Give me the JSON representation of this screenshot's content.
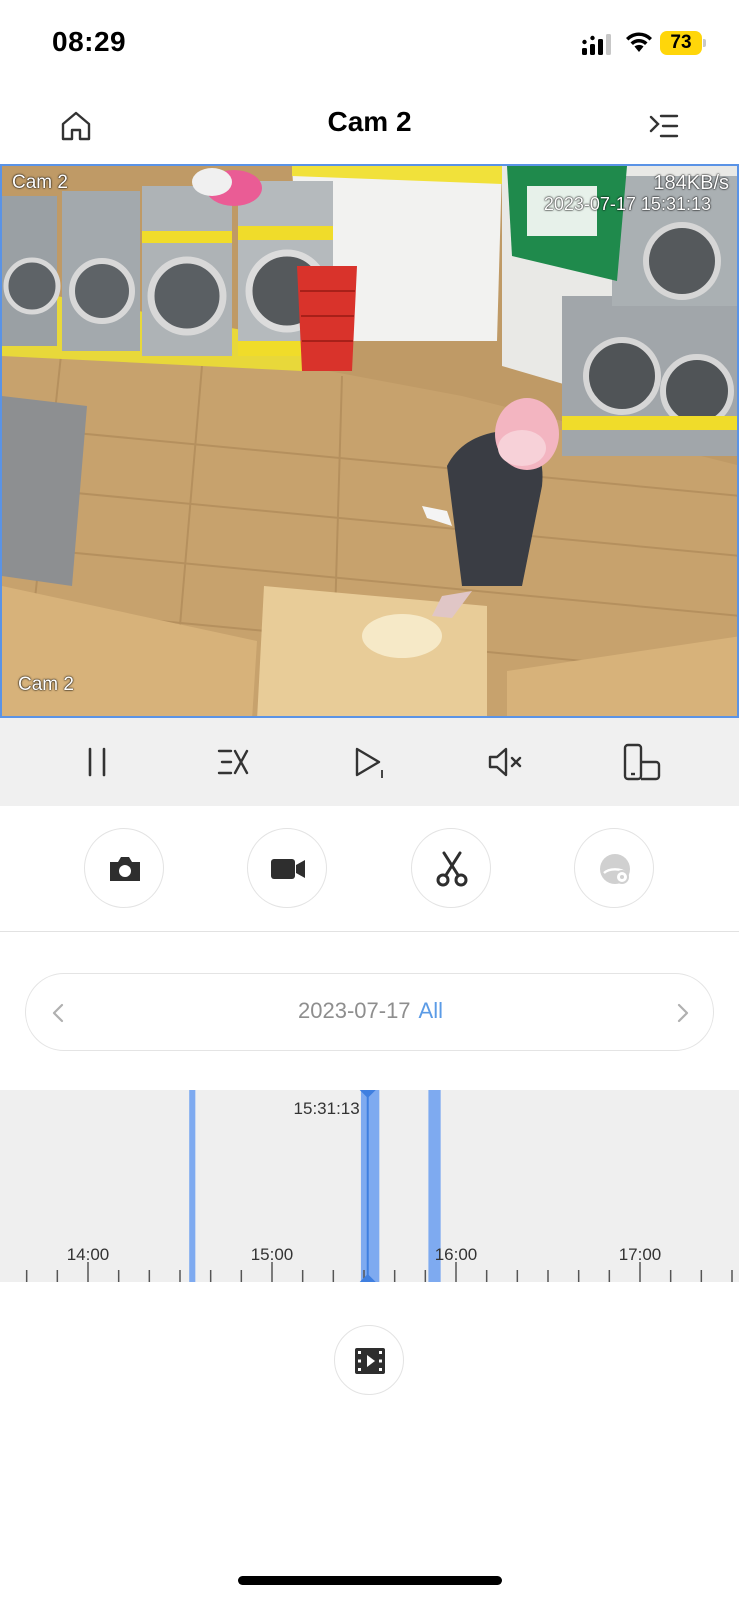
{
  "status_bar": {
    "time": "08:29",
    "battery_level": "73",
    "battery_color": "#ffd60a"
  },
  "nav": {
    "title": "Cam 2",
    "home_icon": "home-icon",
    "menu_icon": "menu-icon"
  },
  "video": {
    "overlay_camera_top": "Cam 2",
    "overlay_camera_bottom": "Cam 2",
    "overlay_bitrate": "184KB/s",
    "overlay_timestamp": "2023-07-17 15:31:13"
  },
  "controls": {
    "items": [
      {
        "icon": "pause-icon"
      },
      {
        "icon": "speed-icon"
      },
      {
        "icon": "frame-step-icon"
      },
      {
        "icon": "mute-icon"
      },
      {
        "icon": "rotate-fullscreen-icon"
      }
    ]
  },
  "actions": {
    "items": [
      {
        "icon": "camera-icon"
      },
      {
        "icon": "video-record-icon"
      },
      {
        "icon": "scissors-icon"
      },
      {
        "icon": "fisheye-icon",
        "disabled": true
      }
    ]
  },
  "date_selector": {
    "date": "2023-07-17",
    "filter": "All",
    "prev_icon": "chevron-left-icon",
    "next_icon": "chevron-right-icon",
    "accent_color": "#5b9be6"
  },
  "timeline": {
    "cursor_time": "15:31:13",
    "hour_labels": [
      "14:00",
      "15:00",
      "16:00",
      "17:00"
    ],
    "recordings": [
      {
        "start": "14:33",
        "end": "14:35"
      },
      {
        "start": "15:29",
        "end": "15:35"
      },
      {
        "start": "15:51",
        "end": "15:55"
      }
    ],
    "recording_color": "#7eaaf0"
  },
  "clips": {
    "icon": "clip-list-icon"
  }
}
